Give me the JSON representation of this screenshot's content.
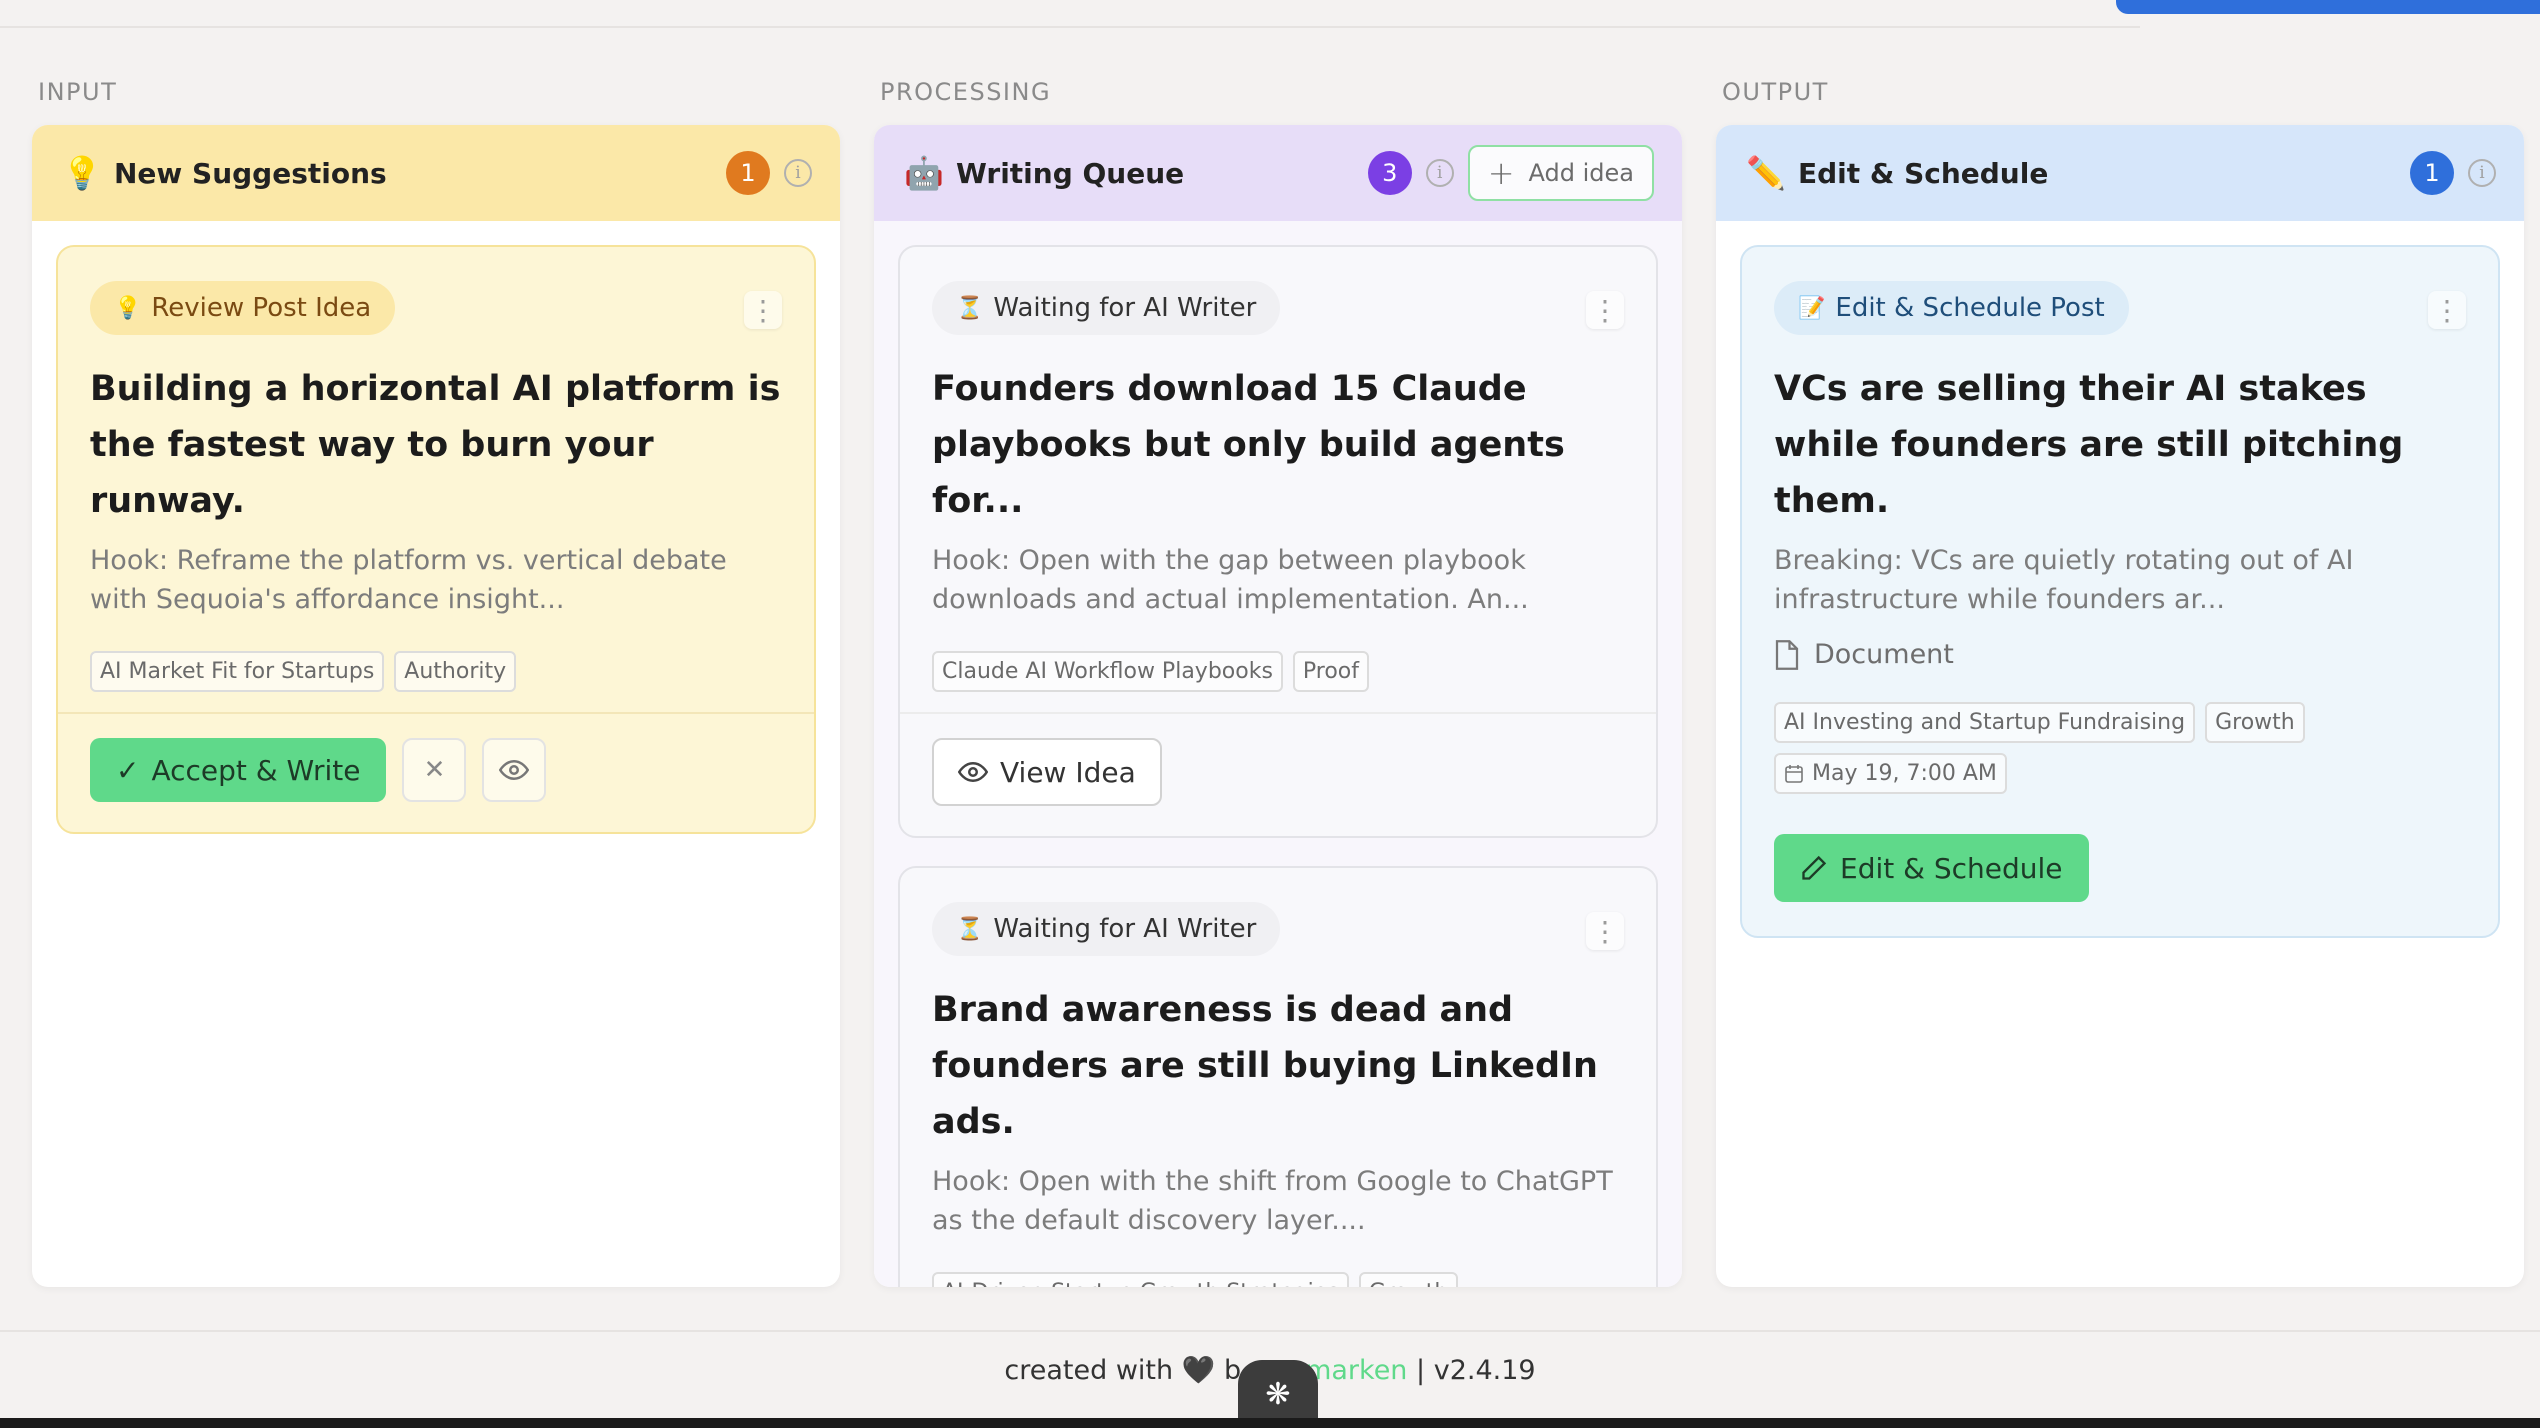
{
  "sections": {
    "input": "INPUT",
    "processing": "PROCESSING",
    "output": "OUTPUT"
  },
  "columns": {
    "suggestions": {
      "title": "New Suggestions",
      "count": "1",
      "icon": "lightbulb-icon",
      "header_color": "#fbe8a8",
      "badge_color": "#e07a1f",
      "card": {
        "status": "Review Post Idea",
        "title": "Building a horizontal AI platform is the fastest way to burn your runway.",
        "hook": "Hook: Reframe the platform vs. vertical debate with Sequoia's affordance insight...",
        "tags": [
          "AI Market Fit for Startups",
          "Authority"
        ],
        "accept_label": "Accept & Write"
      }
    },
    "queue": {
      "title": "Writing Queue",
      "count": "3",
      "icon": "robot-icon",
      "header_color": "#e7ddf8",
      "badge_color": "#7b3fe4",
      "add_idea_label": "Add idea",
      "cards": [
        {
          "status": "Waiting for AI Writer",
          "title": "Founders download 15 Claude playbooks but only build agents for...",
          "hook": "Hook: Open with the gap between playbook downloads and actual implementation. An...",
          "tags": [
            "Claude AI Workflow Playbooks",
            "Proof"
          ],
          "view_label": "View Idea"
        },
        {
          "status": "Waiting for AI Writer",
          "title": "Brand awareness is dead and founders are still buying LinkedIn ads.",
          "hook": "Hook: Open with the shift from Google to ChatGPT as the default discovery layer....",
          "tags": [
            "AI-Driven Startup Growth Strategies",
            "Growth"
          ]
        }
      ]
    },
    "schedule": {
      "title": "Edit & Schedule",
      "count": "1",
      "icon": "pencil-icon",
      "header_color": "#d6e6fa",
      "badge_color": "#2f6fdb",
      "card": {
        "status": "Edit & Schedule Post",
        "title": "VCs are selling their AI stakes while founders are still pitching them.",
        "hook": "Breaking: VCs are quietly rotating out of AI infrastructure while founders ar...",
        "doc_label": "Document",
        "tags": [
          "AI Investing and Startup Fundraising",
          "Growth"
        ],
        "date": "May 19, 7:00 AM",
        "edit_label": "Edit & Schedule"
      }
    }
  },
  "footer": {
    "prefix": "created with",
    "heart": "🖤",
    "by": "b",
    "brand": "marken",
    "version": "| v2.4.19"
  }
}
